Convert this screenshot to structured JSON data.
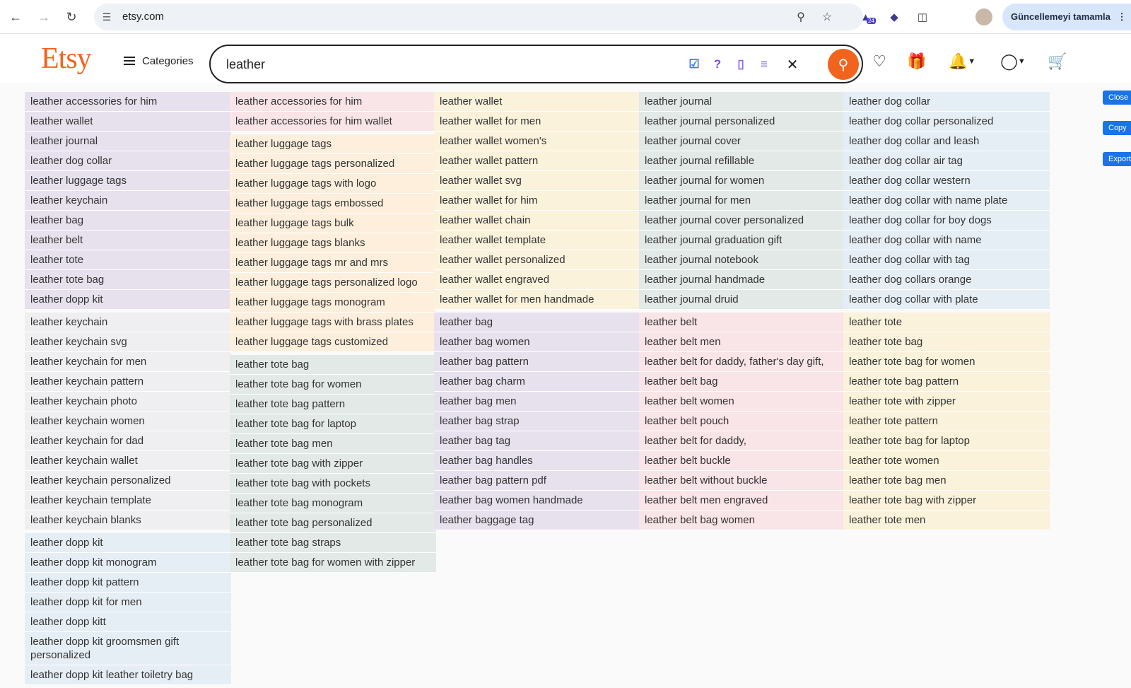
{
  "browser": {
    "url": "etsy.com",
    "update_label": "Güncellemeyi tamamla",
    "ext_badge": "24"
  },
  "etsy": {
    "logo": "Etsy",
    "categories_label": "Categories",
    "search_value": "leather"
  },
  "side_buttons": {
    "close": "Close",
    "copy": "Copy",
    "export": "Export"
  },
  "columns": [
    {
      "groups": [
        {
          "color": "purple",
          "items": [
            "leather accessories for him",
            "leather wallet",
            "leather journal",
            "leather dog collar",
            "leather luggage tags",
            "leather keychain",
            "leather bag",
            "leather belt",
            "leather tote",
            "leather tote bag",
            "leather dopp kit"
          ]
        },
        {
          "color": "gray",
          "items": [
            "leather keychain",
            "leather keychain svg",
            "leather keychain for men",
            "leather keychain pattern",
            "leather keychain photo",
            "leather keychain women",
            "leather keychain for dad",
            "leather keychain wallet",
            "leather keychain personalized",
            "leather keychain template",
            "leather keychain blanks"
          ]
        },
        {
          "color": "blue",
          "items": [
            "leather dopp kit",
            "leather dopp kit monogram",
            "leather dopp kit pattern",
            "leather dopp kit for men",
            "leather dopp kitt",
            "leather dopp kit groomsmen gift personalized",
            "leather dopp kit leather toiletry bag"
          ]
        }
      ]
    },
    {
      "groups": [
        {
          "color": "pink",
          "items": [
            "leather accessories for him",
            "leather accessories for him wallet"
          ]
        },
        {
          "color": "peach",
          "items": [
            "leather luggage tags",
            "leather luggage tags personalized",
            "leather luggage tags with logo",
            "leather luggage tags embossed",
            "leather luggage tags bulk",
            "leather luggage tags blanks",
            "leather luggage tags mr and mrs",
            "leather luggage tags personalized logo",
            "leather luggage tags monogram",
            "leather luggage tags with brass plates",
            "leather luggage tags customized"
          ]
        },
        {
          "color": "green",
          "items": [
            "leather tote bag",
            "leather tote bag for women",
            "leather tote bag pattern",
            "leather tote bag for laptop",
            "leather tote bag men",
            "leather tote bag with zipper",
            "leather tote bag with pockets",
            "leather tote bag monogram",
            "leather tote bag personalized",
            "leather tote bag straps",
            "leather tote bag for women with zipper"
          ]
        }
      ]
    },
    {
      "groups": [
        {
          "color": "yellow",
          "items": [
            "leather wallet",
            "leather wallet for men",
            "leather wallet women's",
            "leather wallet pattern",
            "leather wallet svg",
            "leather wallet for him",
            "leather wallet chain",
            "leather wallet template",
            "leather wallet personalized",
            "leather wallet engraved",
            "leather wallet for men handmade"
          ]
        },
        {
          "color": "purple",
          "items": [
            "leather bag",
            "leather bag women",
            "leather bag pattern",
            "leather bag charm",
            "leather bag men",
            "leather bag strap",
            "leather bag tag",
            "leather bag handles",
            "leather bag pattern pdf",
            "leather bag women handmade",
            "leather baggage tag"
          ]
        }
      ]
    },
    {
      "groups": [
        {
          "color": "green",
          "items": [
            "leather journal",
            "leather journal personalized",
            "leather journal cover",
            "leather journal refillable",
            "leather journal for women",
            "leather journal for men",
            "leather journal cover personalized",
            "leather journal graduation gift",
            "leather journal notebook",
            "leather journal handmade",
            "leather journal druid"
          ]
        },
        {
          "color": "pink",
          "items": [
            "leather belt",
            "leather belt men",
            "leather belt for daddy, father's day gift,",
            "leather belt bag",
            "leather belt women",
            "leather belt pouch",
            "leather belt for daddy,",
            "leather belt buckle",
            "leather belt without buckle",
            "leather belt men engraved",
            "leather belt bag women"
          ]
        }
      ]
    },
    {
      "groups": [
        {
          "color": "blue",
          "items": [
            "leather dog collar",
            "leather dog collar personalized",
            "leather dog collar and leash",
            "leather dog collar air tag",
            "leather dog collar western",
            "leather dog collar with name plate",
            "leather dog collar for boy dogs",
            "leather dog collar with name",
            "leather dog collar with tag",
            "leather dog collars orange",
            "leather dog collar with plate"
          ]
        },
        {
          "color": "yellow",
          "items": [
            "leather tote",
            "leather tote bag",
            "leather tote bag for women",
            "leather tote bag pattern",
            "leather tote with zipper",
            "leather tote pattern",
            "leather tote bag for laptop",
            "leather tote women",
            "leather tote bag men",
            "leather tote bag with zipper",
            "leather tote men"
          ]
        }
      ]
    }
  ]
}
